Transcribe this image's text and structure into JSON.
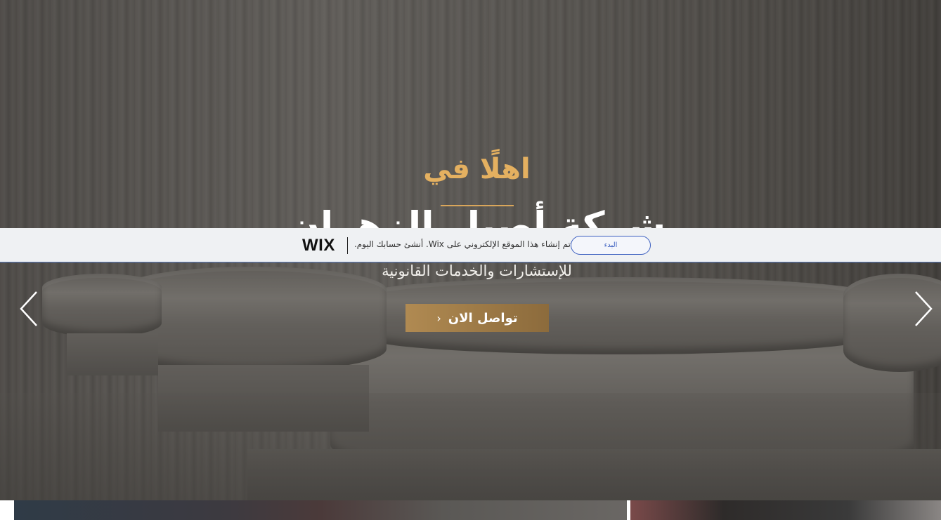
{
  "hero": {
    "welcome": "اهلًا في",
    "company_name": "شركة أصيل الزهران",
    "tagline": "للإستشارات والخدمات القانونية",
    "cta_label": "تواصل الان",
    "cta_icon": "chevron-left-icon",
    "prev_icon": "chevron-left-icon",
    "next_icon": "chevron-right-icon"
  },
  "wix_banner": {
    "logo": "WIX",
    "message": "تم إنشاء هذا الموقع الإلكتروني على Wix. أنشئ حسابك اليوم.",
    "start_label": "البدء"
  },
  "colors": {
    "accent_gold": "#e4b060",
    "cta_gold": "#b08a52",
    "banner_blue": "#3b5fc0"
  }
}
